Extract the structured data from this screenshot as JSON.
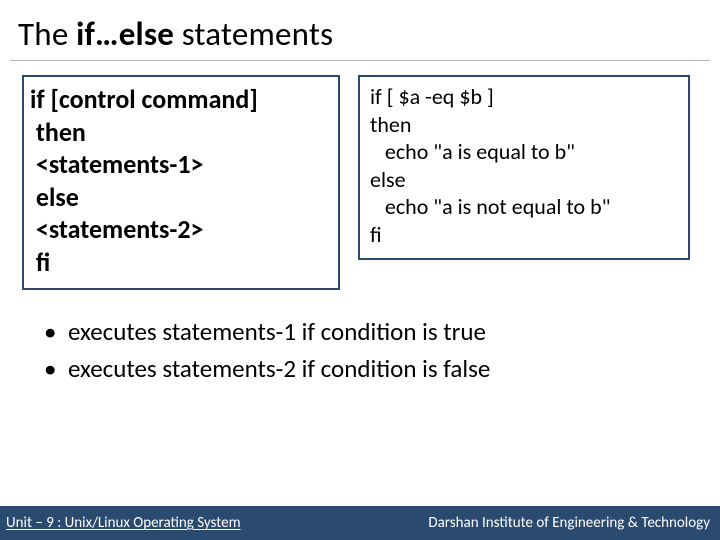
{
  "title": {
    "pre": "The ",
    "bold": "if…else",
    "post": " statements"
  },
  "syntax": {
    "lines": [
      "if [control command]",
      " then",
      " <statements-1>",
      " else",
      " <statements-2>",
      " fi"
    ]
  },
  "example": {
    "lines": [
      "if [ $a -eq $b ]",
      "then",
      "   echo \"a is equal to b\"",
      "else",
      "   echo \"a is not equal to b\"",
      "fi"
    ]
  },
  "bullets": [
    "executes statements-1 if condition is true",
    "executes statements-2 if condition is false"
  ],
  "footer": {
    "left": "Unit – 9  : Unix/Linux Operating System",
    "right": "Darshan Institute of Engineering & Technology"
  }
}
